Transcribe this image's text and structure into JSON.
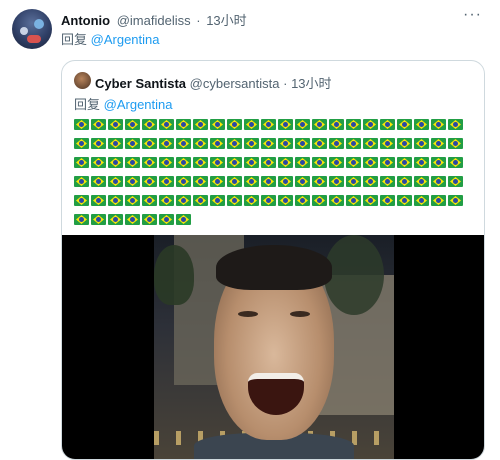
{
  "tweet": {
    "author_name": "Antonio",
    "author_handle": "@imafideliss",
    "separator": "·",
    "time": "13小时",
    "more_label": "···",
    "reply_prefix": "回复",
    "reply_mention": "@Argentina"
  },
  "quoted": {
    "author_name": "Cyber Santista",
    "author_handle": "@cybersantista",
    "separator": "·",
    "time": "13小时",
    "reply_prefix": "回复",
    "reply_mention": "@Argentina",
    "flag_emoji": "🇧🇷",
    "flag_rows": [
      23,
      23,
      23,
      23,
      23,
      7
    ]
  },
  "colors": {
    "link": "#1d9bf0",
    "secondary_text": "#536471",
    "border": "#cfd9de"
  },
  "icons": {
    "more": "more-icon",
    "flag": "brazil-flag-icon"
  }
}
